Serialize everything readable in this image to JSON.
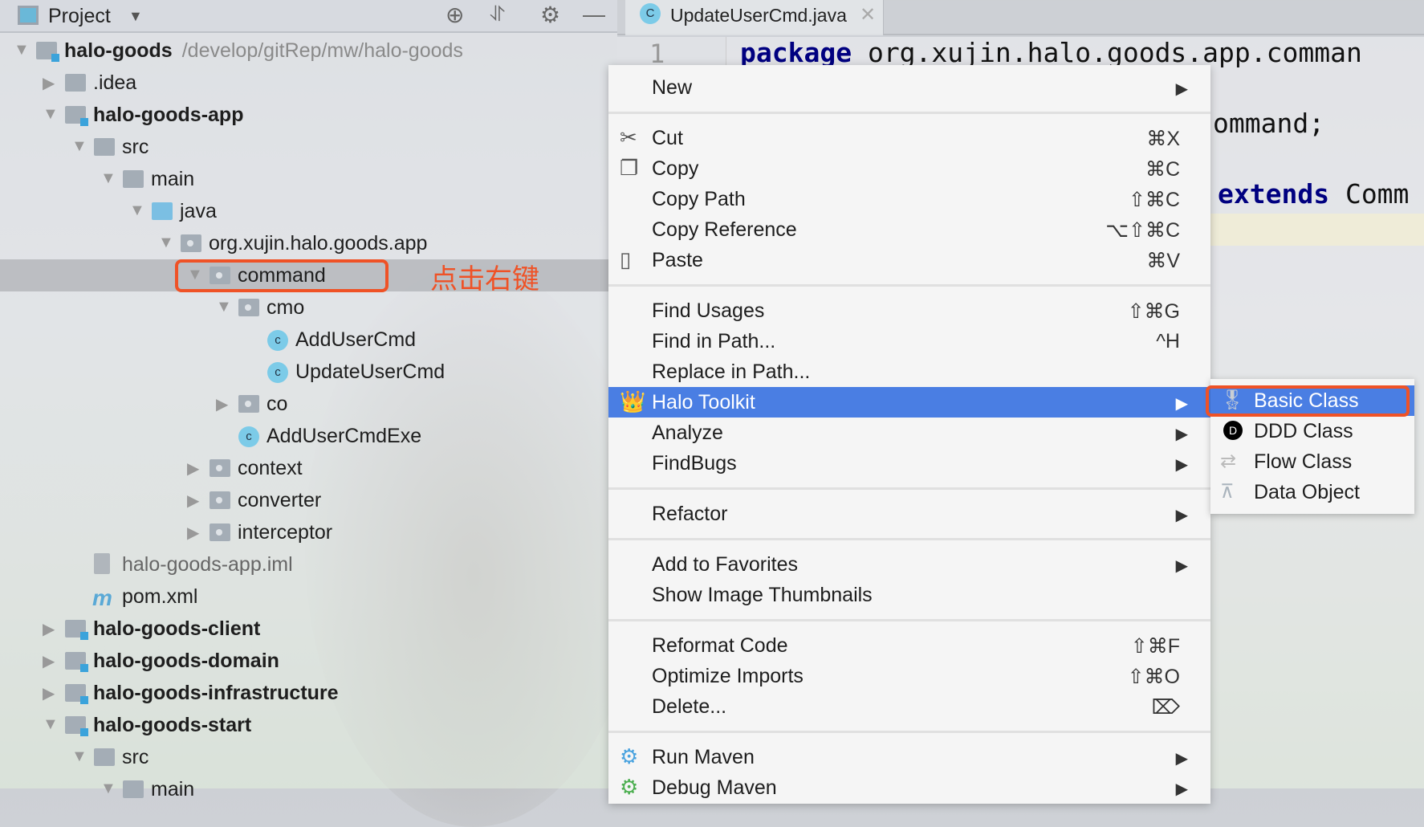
{
  "project_panel": {
    "title": "Project",
    "toolbar_icons": [
      "locate-icon",
      "collapse-icon",
      "gear-icon",
      "minimize-icon"
    ],
    "tree": [
      {
        "label": "halo-goods",
        "path": "/develop/gitRep/mw/halo-goods",
        "depth": 0,
        "expanded": true,
        "icon": "module",
        "bold": true
      },
      {
        "label": ".idea",
        "depth": 1,
        "expanded": false,
        "icon": "folder"
      },
      {
        "label": "halo-goods-app",
        "depth": 1,
        "expanded": true,
        "icon": "module",
        "bold": true
      },
      {
        "label": "src",
        "depth": 2,
        "expanded": true,
        "icon": "folder"
      },
      {
        "label": "main",
        "depth": 3,
        "expanded": true,
        "icon": "folder"
      },
      {
        "label": "java",
        "depth": 4,
        "expanded": true,
        "icon": "source-folder"
      },
      {
        "label": "org.xujin.halo.goods.app",
        "depth": 5,
        "expanded": true,
        "icon": "package"
      },
      {
        "label": "command",
        "depth": 6,
        "expanded": true,
        "icon": "package",
        "selected": true
      },
      {
        "label": "cmo",
        "depth": 7,
        "expanded": true,
        "icon": "package"
      },
      {
        "label": "AddUserCmd",
        "depth": 8,
        "icon": "class"
      },
      {
        "label": "UpdateUserCmd",
        "depth": 8,
        "icon": "class"
      },
      {
        "label": "co",
        "depth": 7,
        "expanded": false,
        "icon": "package"
      },
      {
        "label": "AddUserCmdExe",
        "depth": 7,
        "icon": "class"
      },
      {
        "label": "context",
        "depth": 6,
        "expanded": false,
        "icon": "package"
      },
      {
        "label": "converter",
        "depth": 6,
        "expanded": false,
        "icon": "package"
      },
      {
        "label": "interceptor",
        "depth": 6,
        "expanded": false,
        "icon": "package"
      },
      {
        "label": "halo-goods-app.iml",
        "depth": 2,
        "icon": "iml",
        "muted": true
      },
      {
        "label": "pom.xml",
        "depth": 2,
        "icon": "maven"
      },
      {
        "label": "halo-goods-client",
        "depth": 1,
        "expanded": false,
        "icon": "module",
        "bold": true
      },
      {
        "label": "halo-goods-domain",
        "depth": 1,
        "expanded": false,
        "icon": "module",
        "bold": true
      },
      {
        "label": "halo-goods-infrastructure",
        "depth": 1,
        "expanded": false,
        "icon": "module",
        "bold": true
      },
      {
        "label": "halo-goods-start",
        "depth": 1,
        "expanded": true,
        "icon": "module",
        "bold": true
      },
      {
        "label": "src",
        "depth": 2,
        "expanded": true,
        "icon": "folder"
      },
      {
        "label": "main",
        "depth": 3,
        "expanded": true,
        "icon": "folder"
      }
    ],
    "annotation": "点击右键"
  },
  "editor": {
    "tab": {
      "label": "UpdateUserCmd.java",
      "icon": "C"
    },
    "line_numbers": [
      "1"
    ],
    "lines": [
      {
        "kw": "package",
        "rest": " org.xujin.halo.goods.app.comman"
      },
      {
        "kw": "",
        "rest": "ommand;"
      },
      {
        "kw": "extends",
        "rest": " Comm"
      }
    ]
  },
  "context_menu": {
    "groups": [
      [
        {
          "label": "New",
          "submenu": true
        }
      ],
      [
        {
          "label": "Cut",
          "shortcut": "⌘X",
          "icon": "scissors-icon"
        },
        {
          "label": "Copy",
          "shortcut": "⌘C",
          "icon": "copy-icon"
        },
        {
          "label": "Copy Path",
          "shortcut": "⇧⌘C"
        },
        {
          "label": "Copy Reference",
          "shortcut": "⌥⇧⌘C"
        },
        {
          "label": "Paste",
          "shortcut": "⌘V",
          "icon": "clipboard-icon"
        }
      ],
      [
        {
          "label": "Find Usages",
          "shortcut": "⇧⌘G"
        },
        {
          "label": "Find in Path...",
          "shortcut": "^H"
        },
        {
          "label": "Replace in Path..."
        },
        {
          "label": "Halo Toolkit",
          "submenu": true,
          "icon": "crown-icon",
          "highlighted": true
        },
        {
          "label": "Analyze",
          "submenu": true
        },
        {
          "label": "FindBugs",
          "submenu": true
        }
      ],
      [
        {
          "label": "Refactor",
          "submenu": true
        }
      ],
      [
        {
          "label": "Add to Favorites",
          "submenu": true
        },
        {
          "label": "Show Image Thumbnails"
        }
      ],
      [
        {
          "label": "Reformat Code",
          "shortcut": "⇧⌘F"
        },
        {
          "label": "Optimize Imports",
          "shortcut": "⇧⌘O"
        },
        {
          "label": "Delete...",
          "shortcut": "⌦"
        }
      ],
      [
        {
          "label": "Run Maven",
          "submenu": true,
          "icon": "maven-run-icon"
        },
        {
          "label": "Debug Maven",
          "submenu": true,
          "icon": "maven-debug-icon"
        }
      ]
    ]
  },
  "submenu": {
    "items": [
      {
        "label": "Basic Class",
        "icon": "badge-icon",
        "highlighted": true
      },
      {
        "label": "DDD Class",
        "icon": "ddd-icon"
      },
      {
        "label": "Flow Class",
        "icon": "flow-icon"
      },
      {
        "label": "Data Object",
        "icon": "hierarchy-icon"
      }
    ]
  },
  "colors": {
    "highlight": "#4a7ee3",
    "annotation": "#ef5226",
    "keyword": "#000080"
  }
}
